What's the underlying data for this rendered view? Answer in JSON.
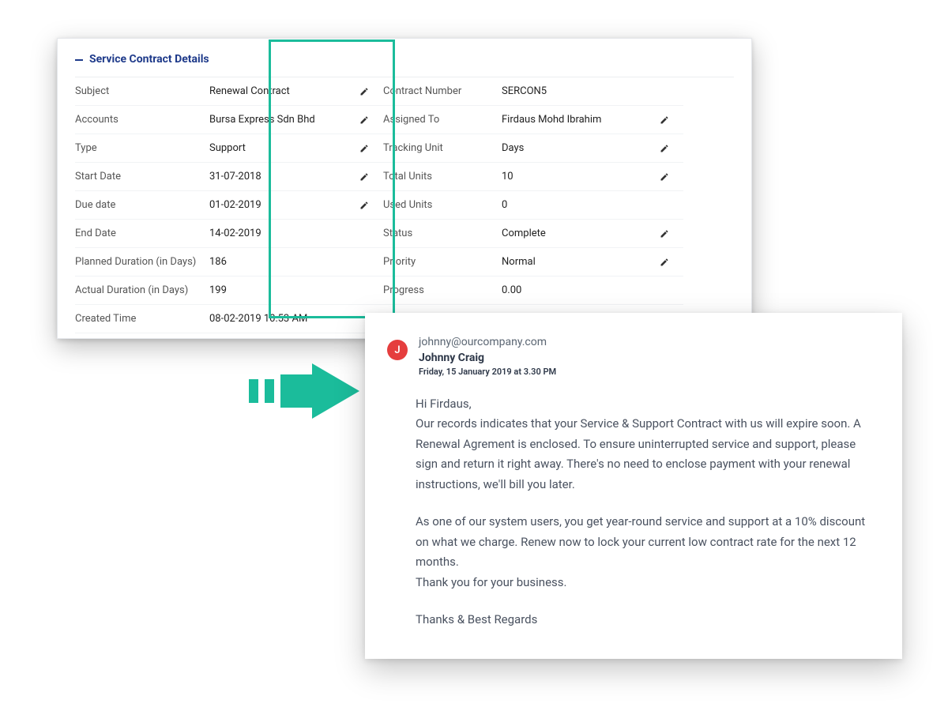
{
  "section_title": "Service Contract Details",
  "left_fields": [
    {
      "label": "Subject",
      "value": "Renewal Contract",
      "editable": true
    },
    {
      "label": "Accounts",
      "value": "Bursa Express Sdn Bhd",
      "editable": true
    },
    {
      "label": "Type",
      "value": "Support",
      "editable": true
    },
    {
      "label": "Start Date",
      "value": "31-07-2018",
      "editable": true
    },
    {
      "label": "Due date",
      "value": "01-02-2019",
      "editable": true
    },
    {
      "label": "End Date",
      "value": "14-02-2019",
      "editable": false
    },
    {
      "label": "Planned Duration (in Days)",
      "value": "186",
      "editable": false
    },
    {
      "label": "Actual Duration (in Days)",
      "value": "199",
      "editable": false
    },
    {
      "label": "Created Time",
      "value": "08-02-2019 10:53 AM",
      "editable": false
    }
  ],
  "right_fields": [
    {
      "label": "Contract Number",
      "value": "SERCON5",
      "editable": false
    },
    {
      "label": "Assigned To",
      "value": "Firdaus Mohd Ibrahim",
      "editable": true
    },
    {
      "label": "Tracking Unit",
      "value": "Days",
      "editable": true
    },
    {
      "label": "Total Units",
      "value": "10",
      "editable": true
    },
    {
      "label": "Used Units",
      "value": "0",
      "editable": false
    },
    {
      "label": "Status",
      "value": "Complete",
      "editable": true
    },
    {
      "label": "Priority",
      "value": "Normal",
      "editable": true
    },
    {
      "label": "Progress",
      "value": "0.00",
      "editable": false
    }
  ],
  "email": {
    "avatar_initial": "J",
    "address": "johnny@ourcompany.com",
    "name": "Johnny Craig",
    "date": "Friday, 15 January 2019 at 3.30 PM",
    "greeting": "Hi Firdaus,",
    "p1": "Our records indicates that your Service & Support Contract with us will expire soon. A Renewal Agrement is enclosed. To ensure uninterrupted service and support, please sign and return it right away. There's no need to enclose payment with your renewal instructions, we'll bill you later.",
    "p2": "As one of our system users, you get year-round service and support at a 10% discount on what we charge. Renew now to lock your current low contract rate for the next 12 months.",
    "p3": "Thank you for your business.",
    "signoff": "Thanks & Best Regards"
  },
  "colors": {
    "accent": "#1bbc9b",
    "link": "#1e3a8a",
    "avatar": "#e53e3e"
  }
}
